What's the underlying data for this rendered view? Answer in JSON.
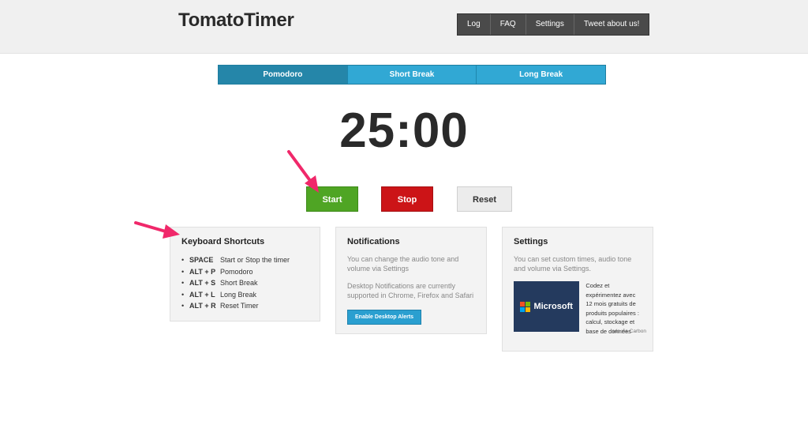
{
  "header": {
    "logo": "TomatoTimer",
    "nav": [
      "Log",
      "FAQ",
      "Settings",
      "Tweet about us!"
    ]
  },
  "tabs": [
    {
      "label": "Pomodoro",
      "active": true
    },
    {
      "label": "Short Break",
      "active": false
    },
    {
      "label": "Long Break",
      "active": false
    }
  ],
  "timer": {
    "display": "25:00"
  },
  "controls": {
    "start": "Start",
    "stop": "Stop",
    "reset": "Reset"
  },
  "keyboard": {
    "title": "Keyboard Shortcuts",
    "shortcuts": [
      {
        "key": "SPACE",
        "action": "Start or Stop the timer"
      },
      {
        "key": "ALT + P",
        "action": "Pomodoro"
      },
      {
        "key": "ALT + S",
        "action": "Short Break"
      },
      {
        "key": "ALT + L",
        "action": "Long Break"
      },
      {
        "key": "ALT + R",
        "action": "Reset Timer"
      }
    ]
  },
  "notifications": {
    "title": "Notifications",
    "text1": "You can change the audio tone and volume via Settings",
    "text2": "Desktop Notifications are currently supported in Chrome, Firefox and Safari",
    "button": "Enable Desktop Alerts"
  },
  "settings": {
    "title": "Settings",
    "text": "You can set custom times, audio tone and volume via Settings.",
    "ad": {
      "brand": "Microsoft",
      "text": "Codez et expérimentez avec 12 mois gratuits de produits populaires : calcul, stockage et base de données",
      "credit": "ads via Carbon"
    }
  },
  "colors": {
    "start": "#4fa524",
    "stop": "#cc1417",
    "tab_active": "#2586a9",
    "tab": "#31a8d4",
    "arrow": "#f0286a",
    "ms_red": "#f25022",
    "ms_green": "#7fba00",
    "ms_blue": "#00a4ef",
    "ms_yellow": "#ffb900"
  }
}
